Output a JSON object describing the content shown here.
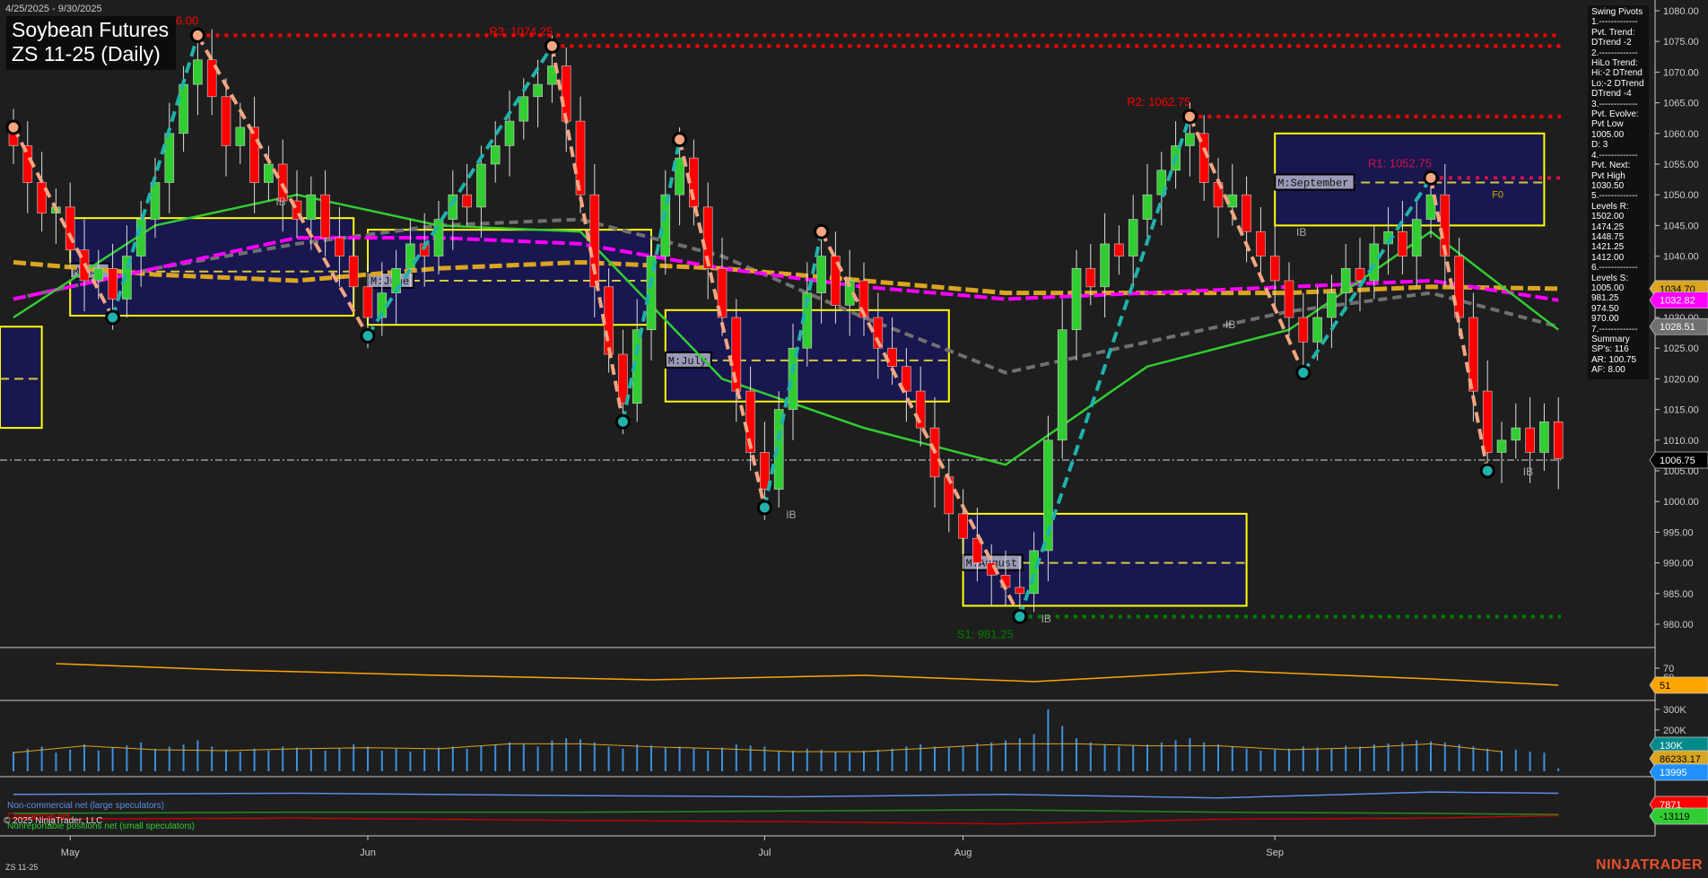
{
  "header": {
    "date_range": "4/25/2025 - 9/30/2025",
    "title_line1": "Soybean Futures",
    "title_line2": "ZS 11-25 (Daily)"
  },
  "info_panel": {
    "lines": [
      "Swing Pivots",
      "1.-------------",
      "Pvt. Trend:",
      "DTrend -2",
      "2.-------------",
      "HiLo Trend:",
      "Hi:-2 DTrend",
      "Lo:-2 DTrend",
      "DTrend -4",
      "3.-------------",
      "Pvt. Evolve:",
      "Pvt Low",
      "1005.00",
      "D: 3",
      "4.-------------",
      "Pvt. Next:",
      "Pvt High",
      "1030.50",
      "5.-------------",
      "Levels R:",
      "1502.00",
      "1474.25",
      "1448.75",
      "1421.25",
      "1412.00",
      "6.-------------",
      "Levels S:",
      "1005.00",
      "981.25",
      "974.50",
      "970.00",
      "7.-------------",
      "Summary",
      "SP's: 116",
      "AR: 100.75",
      "AF: 8.00"
    ]
  },
  "footer": {
    "symbol": "ZS 11-25",
    "copyright": "© 2025 NinjaTrader, LLC",
    "logo": "NINJATRADER"
  },
  "cot_legend": {
    "noncommercial": "Non-commercial net (large speculators)",
    "commercial": "Commercial net",
    "nonreportable": "Nonreportable positions net (small speculators)"
  },
  "colors": {
    "up": "#32cd32",
    "down": "#ff0000",
    "ma_magenta": "#ff00ff",
    "ma_orange": "#daa520",
    "ma_gray": "#707070",
    "ma_green": "#32cd32",
    "box_fill": "#19174f",
    "box_border": "#ffff00",
    "zig_up": "#20b2aa",
    "zig_down": "#f4a582"
  },
  "chart_data": {
    "type": "candlestick",
    "title": "Soybean Futures ZS 11-25 (Daily)",
    "ylim": [
      978,
      1082
    ],
    "y_ticks": [
      "1080.00",
      "1075.00",
      "1070.00",
      "1065.00",
      "1060.00",
      "1055.00",
      "1050.00",
      "1045.00",
      "1040.00",
      "1035.00",
      "1030.00",
      "1025.00",
      "1020.00",
      "1015.00",
      "1010.00",
      "1005.00",
      "1000.00",
      "995.00",
      "990.00",
      "985.00",
      "980.00"
    ],
    "x_labels": [
      {
        "label": "May",
        "bar": 4
      },
      {
        "label": "Jun",
        "bar": 25
      },
      {
        "label": "Jul",
        "bar": 53
      },
      {
        "label": "Aug",
        "bar": 67
      },
      {
        "label": "Sep",
        "bar": 89
      }
    ],
    "closes": [
      1058,
      1052,
      1047,
      1048,
      1041,
      1036,
      1038,
      1033,
      1040,
      1046,
      1052,
      1060,
      1068,
      1072,
      1066,
      1058,
      1061,
      1052,
      1055,
      1049,
      1046,
      1050,
      1043,
      1040,
      1035,
      1030,
      1034,
      1038,
      1042,
      1040,
      1046,
      1050,
      1048,
      1055,
      1058,
      1062,
      1066,
      1068,
      1071,
      1062,
      1050,
      1035,
      1024,
      1016,
      1028,
      1040,
      1050,
      1056,
      1048,
      1038,
      1030,
      1018,
      1008,
      1002,
      1015,
      1025,
      1034,
      1040,
      1032,
      1036,
      1030,
      1025,
      1022,
      1018,
      1012,
      1004,
      998,
      994,
      990,
      988,
      986,
      985,
      992,
      1010,
      1028,
      1038,
      1035,
      1042,
      1040,
      1046,
      1050,
      1054,
      1058,
      1060,
      1052,
      1048,
      1050,
      1044,
      1040,
      1036,
      1030,
      1026,
      1030,
      1034,
      1038,
      1036,
      1042,
      1044,
      1040,
      1046,
      1050,
      1040,
      1030,
      1018,
      1008,
      1010,
      1012,
      1008,
      1013,
      1007
    ],
    "volume_k": [
      95,
      110,
      120,
      90,
      105,
      130,
      100,
      115,
      125,
      140,
      110,
      120,
      130,
      150,
      120,
      105,
      95,
      110,
      100,
      120,
      115,
      105,
      100,
      110,
      130,
      120,
      100,
      110,
      95,
      105,
      115,
      120,
      110,
      125,
      130,
      140,
      135,
      120,
      150,
      160,
      155,
      140,
      120,
      110,
      130,
      125,
      115,
      120,
      110,
      100,
      115,
      130,
      125,
      120,
      95,
      100,
      110,
      105,
      95,
      90,
      100,
      105,
      110,
      120,
      130,
      120,
      115,
      125,
      135,
      140,
      150,
      160,
      180,
      300,
      220,
      160,
      140,
      130,
      120,
      125,
      130,
      140,
      150,
      160,
      140,
      130,
      120,
      110,
      100,
      105,
      110,
      120,
      115,
      110,
      125,
      120,
      130,
      135,
      140,
      150,
      145,
      140,
      130,
      120,
      110,
      100,
      105,
      95,
      90,
      14
    ],
    "oscillator": {
      "bars": [
        3,
        15,
        30,
        45,
        60,
        72,
        86,
        100,
        109
      ],
      "values": [
        75,
        68,
        62,
        57,
        62,
        55,
        67,
        58,
        51
      ],
      "last": "51",
      "ticks": [
        "70",
        "60"
      ]
    },
    "moving_averages": {
      "bars": [
        0,
        10,
        20,
        30,
        40,
        50,
        60,
        70,
        80,
        90,
        100,
        109
      ],
      "magenta": [
        1033,
        1038,
        1043,
        1043,
        1042,
        1038,
        1035,
        1033,
        1034,
        1035,
        1036,
        1032.82
      ],
      "orange": [
        1039,
        1037,
        1036,
        1038,
        1039,
        1038,
        1036,
        1034,
        1034,
        1034,
        1035,
        1034.7
      ],
      "gray": [
        1033,
        1038,
        1042,
        1045,
        1046,
        1040,
        1030,
        1021,
        1026,
        1031,
        1034,
        1028.51
      ],
      "green": [
        1030,
        1045,
        1050,
        1045,
        1044,
        1020,
        1012,
        1006,
        1022,
        1028,
        1044,
        1028
      ]
    },
    "pivots": [
      {
        "bar": 0,
        "price": 1061,
        "type": "high"
      },
      {
        "bar": 7,
        "price": 1030,
        "type": "low"
      },
      {
        "bar": 13,
        "price": 1076,
        "type": "high"
      },
      {
        "bar": 25,
        "price": 1027,
        "type": "low"
      },
      {
        "bar": 38,
        "price": 1074.25,
        "type": "high"
      },
      {
        "bar": 43,
        "price": 1013,
        "type": "low"
      },
      {
        "bar": 47,
        "price": 1059,
        "type": "high"
      },
      {
        "bar": 53,
        "price": 999,
        "type": "low"
      },
      {
        "bar": 57,
        "price": 1044,
        "type": "high"
      },
      {
        "bar": 71,
        "price": 981.25,
        "type": "low"
      },
      {
        "bar": 83,
        "price": 1062.75,
        "type": "high"
      },
      {
        "bar": 91,
        "price": 1021,
        "type": "low"
      },
      {
        "bar": 100,
        "price": 1052.75,
        "type": "high"
      },
      {
        "bar": 104,
        "price": 1005,
        "type": "low"
      }
    ],
    "levels": [
      {
        "label": "R4: 1076.00",
        "price": 1076,
        "from_bar": 13,
        "color": "#ff0000"
      },
      {
        "label": "R3: 1074.25",
        "price": 1074.25,
        "from_bar": 38,
        "color": "#ff0000"
      },
      {
        "label": "R2: 1062.75",
        "price": 1062.75,
        "from_bar": 83,
        "color": "#ff0000"
      },
      {
        "label": "R1: 1052.75",
        "price": 1052.75,
        "from_bar": 100,
        "color": "#d0104c"
      },
      {
        "label": "S1: 981.25",
        "price": 981.25,
        "from_bar": 71,
        "color": "#008000"
      }
    ],
    "monthly_boxes": [
      {
        "label": "",
        "start": -1,
        "end": 2,
        "high": 1028.5,
        "low": 1012,
        "mid": 1020
      },
      {
        "label": "M:May",
        "start": 4,
        "end": 24,
        "high": 1046.2,
        "low": 1030.3,
        "mid": 1037.5
      },
      {
        "label": "M:June",
        "start": 25,
        "end": 45,
        "high": 1044.3,
        "low": 1028.8,
        "mid": 1036
      },
      {
        "label": "M:July",
        "start": 46,
        "end": 66,
        "high": 1031.2,
        "low": 1016.3,
        "mid": 1023
      },
      {
        "label": "M:August",
        "start": 67,
        "end": 87,
        "high": 998,
        "low": 983,
        "mid": 990
      },
      {
        "label": "M:September",
        "start": 89,
        "end": 108,
        "high": 1060,
        "low": 1045,
        "mid": 1052
      },
      {
        "label": "F0",
        "start": 104,
        "end": 104,
        "high": 0,
        "low": 0,
        "mid": 0
      }
    ],
    "ib_marks": [
      {
        "bar": 18,
        "price": 1049
      },
      {
        "bar": 54,
        "price": 998
      },
      {
        "bar": 72,
        "price": 981
      },
      {
        "bar": 85,
        "price": 1029
      },
      {
        "bar": 90,
        "price": 1044
      },
      {
        "bar": 106,
        "price": 1005
      }
    ],
    "price_tags": [
      {
        "value": "1034.70",
        "price": 1034.7,
        "bg": "#daa520",
        "fg": "#000"
      },
      {
        "value": "1032.82",
        "price": 1032.82,
        "bg": "#ff00ff",
        "fg": "#fff"
      },
      {
        "value": "1028.51",
        "price": 1028.51,
        "bg": "#707070",
        "fg": "#fff"
      },
      {
        "value": "1006.75",
        "price": 1006.75,
        "bg": "#000",
        "fg": "#fff"
      }
    ],
    "last_price": 1006.75,
    "volume_axis": {
      "ticks": [
        "300K",
        "200K"
      ],
      "tags": [
        {
          "value": "130K",
          "bg": "#008b8b",
          "fg": "#fff"
        },
        {
          "value": "86233.17",
          "bg": "#daa520",
          "fg": "#000"
        },
        {
          "value": "13995",
          "bg": "#1e90ff",
          "fg": "#fff"
        }
      ]
    },
    "cot": {
      "bars": [
        0,
        20,
        40,
        55,
        70,
        85,
        100,
        109
      ],
      "noncommercial": [
        30,
        28,
        32,
        34,
        30,
        36,
        26,
        28
      ],
      "commercial": [
        72,
        70,
        74,
        76,
        80,
        72,
        70,
        66
      ],
      "nonreportable": [
        62,
        60,
        60,
        58,
        56,
        60,
        62,
        64
      ],
      "tags": [
        {
          "value": "7871",
          "bg": "#ff0000",
          "fg": "#fff"
        },
        {
          "value": "-13119",
          "bg": "#32cd32",
          "fg": "#000"
        }
      ]
    }
  }
}
